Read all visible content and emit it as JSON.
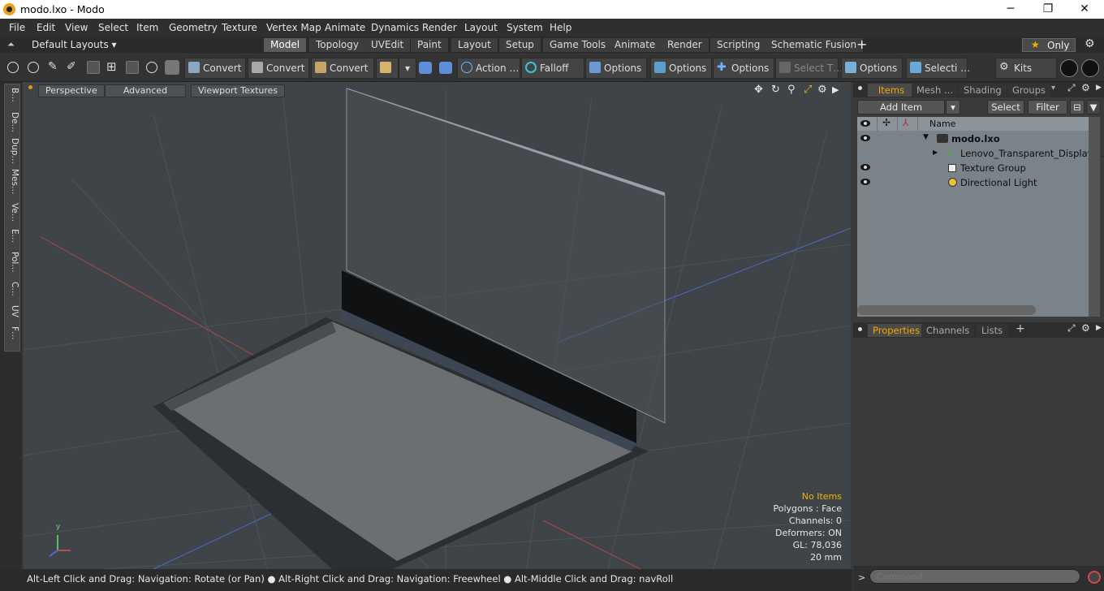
{
  "window": {
    "title": "modo.lxo - Modo",
    "minimize": "─",
    "maximize": "❐",
    "close": "✕"
  },
  "menu": [
    "File",
    "Edit",
    "View",
    "Select",
    "Item",
    "Geometry",
    "Texture",
    "Vertex Map",
    "Animate",
    "Dynamics",
    "Render",
    "Layout",
    "System",
    "Help"
  ],
  "layouts": {
    "selector": "Default Layouts ▾",
    "tabs": [
      "Model",
      "Topology",
      "UVEdit",
      "Paint",
      "Layout",
      "Setup",
      "Game Tools",
      "Animate",
      "Render",
      "Scripting",
      "Schematic Fusion"
    ],
    "active": "Model",
    "add": "+",
    "only": "Only",
    "star": "★"
  },
  "toolbar": {
    "convert1": "Convert",
    "convert2": "Convert",
    "convert3": "Convert",
    "action": "Action  …",
    "falloff": "Falloff",
    "options1": "Options",
    "options2": "Options",
    "options3": "Options",
    "select_t": "Select T…",
    "options4": "Options",
    "selecti": "Selecti …",
    "kits": "Kits"
  },
  "left_tabs": [
    "B…",
    "De…",
    "Dup…",
    "Mes…",
    "Ve…",
    "E…",
    "Pol…",
    "C…",
    "UV",
    "F…"
  ],
  "viewport": {
    "perspective": "Perspective",
    "advanced": "Advanced",
    "textures": "Viewport Textures",
    "stats": {
      "no_items": "No Items",
      "polygons": "Polygons : Face",
      "channels": "Channels: 0",
      "deformers": "Deformers: ON",
      "gl": "GL: 78,036",
      "scale": "20 mm"
    },
    "axis_y": "y",
    "colors": {
      "no_items": "#f0b400",
      "bg": "#3f4448"
    }
  },
  "statusbar": "Alt-Left Click and Drag: Navigation: Rotate (or Pan) ● Alt-Right Click and Drag: Navigation: Freewheel ● Alt-Middle Click and Drag: navRoll",
  "items_panel": {
    "tabs": [
      "Items",
      "Mesh …",
      "Shading",
      "Groups"
    ],
    "active": "Items",
    "add_item": "Add Item",
    "select": "Select",
    "filter": "Filter",
    "col_name": "Name",
    "rows": [
      {
        "label": "modo.lxo"
      },
      {
        "label": "Lenovo_Transparent_Display_…"
      },
      {
        "label": "Texture Group"
      },
      {
        "label": "Directional Light"
      }
    ]
  },
  "props_panel": {
    "tabs": [
      "Properties",
      "Channels",
      "Lists"
    ],
    "active": "Properties",
    "add": "+"
  },
  "command": {
    "placeholder": "Command",
    "prompt": ">"
  }
}
